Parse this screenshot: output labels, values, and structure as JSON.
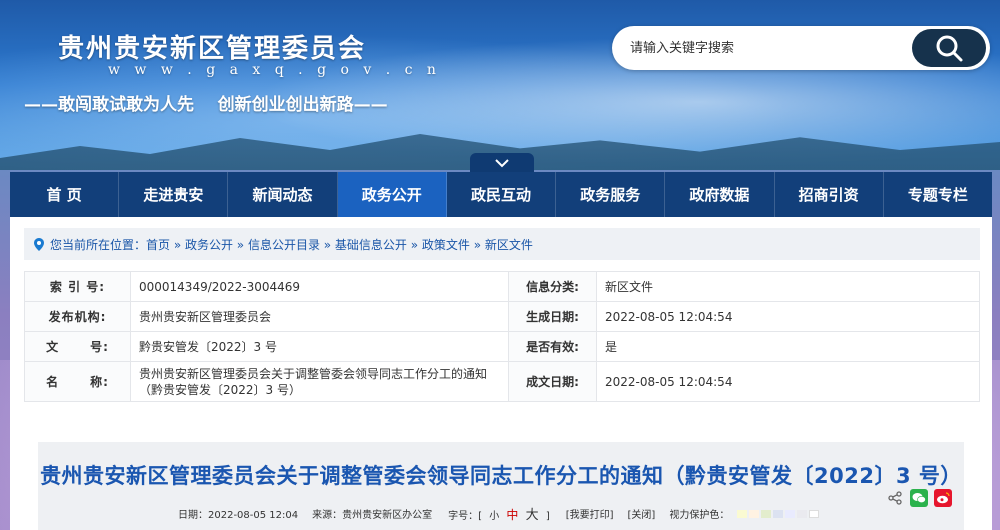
{
  "header": {
    "site_title": "贵州贵安新区管理委员会",
    "site_url": "w w w . g a x q . g o v . c n",
    "slogan": "——敢闯敢试敢为人先    创新创业创出新路——"
  },
  "search": {
    "placeholder": "请输入关键字搜索",
    "button_icon": "search-icon"
  },
  "nav": {
    "items": [
      {
        "label": "首  页"
      },
      {
        "label": "走进贵安"
      },
      {
        "label": "新闻动态"
      },
      {
        "label": "政务公开",
        "active": true
      },
      {
        "label": "政民互动"
      },
      {
        "label": "政务服务"
      },
      {
        "label": "政府数据"
      },
      {
        "label": "招商引资"
      },
      {
        "label": "专题专栏"
      }
    ],
    "active_color": "#1b62c0",
    "bar_color": "#123f7a"
  },
  "breadcrumb": {
    "prefix": "您当前所在位置：",
    "path": "首页 » 政务公开 » 信息公开目录 » 基础信息公开 » 政策文件 » 新区文件"
  },
  "info_table": {
    "rows": [
      {
        "label1": "索 引 号:",
        "value1": "000014349/2022-3004469",
        "label2": "信息分类:",
        "value2": "新区文件"
      },
      {
        "label1": "发布机构:",
        "value1": "贵州贵安新区管理委员会",
        "label2": "生成日期:",
        "value2": "2022-08-05 12:04:54"
      },
      {
        "label1": "文      号:",
        "value1": "黔贵安管发〔2022〕3 号",
        "label2": "是否有效:",
        "value2": "是"
      },
      {
        "label1": "名      称:",
        "value1": "贵州贵安新区管理委员会关于调整管委会领导同志工作分工的通知（黔贵安管发〔2022〕3 号）",
        "label2": "成文日期:",
        "value2": "2022-08-05 12:04:54"
      }
    ]
  },
  "article": {
    "title": "贵州贵安新区管理委员会关于调整管委会领导同志工作分工的通知（黔贵安管发〔2022〕3 号）",
    "date_label": "日期：2022-08-05 12:04",
    "source_label": "来源：贵州贵安新区办公室",
    "font_size_label": "字号：[",
    "size_small": "小",
    "size_medium": "中",
    "size_large": "大",
    "font_size_close": "]",
    "print_label": "[我要打印]",
    "close_label": "[关闭]",
    "eye_care_label": "视力保护色：",
    "eye_colors": [
      "#fafad2",
      "#fff2e2",
      "#e3edcd",
      "#dce2f1",
      "#e9ebfe",
      "#eaeaef",
      "#ffffff"
    ]
  },
  "share": {
    "icons": [
      "share-icon",
      "wechat-icon",
      "weibo-icon"
    ]
  }
}
